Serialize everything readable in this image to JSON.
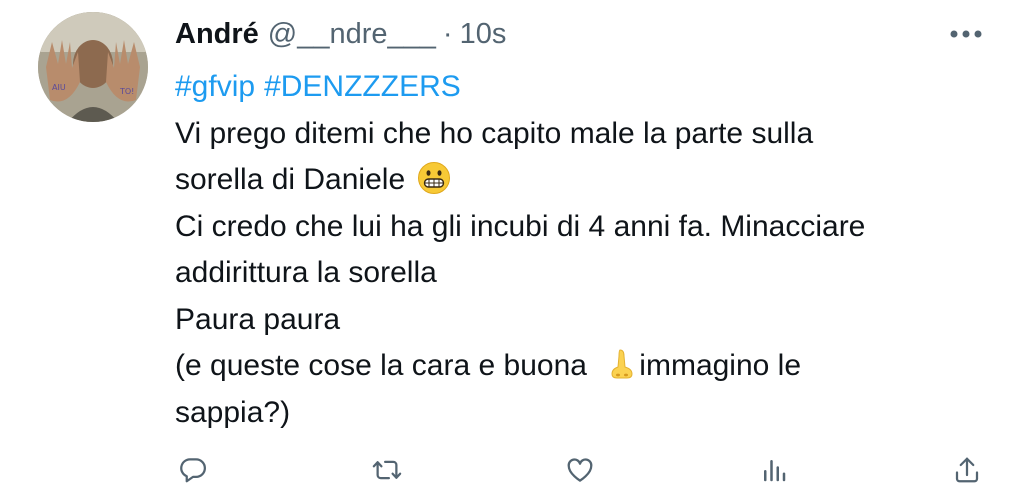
{
  "author": {
    "display_name": "André",
    "handle": "@__ndre___",
    "separator": "·",
    "time": "10s",
    "avatar_hand_text_left": "AIU",
    "avatar_hand_text_right": "TO!"
  },
  "tweet": {
    "hashtags": [
      "#gfvip",
      "#DENZZZERS"
    ],
    "lines": [
      "Vi prego ditemi che ho capito male la parte sulla",
      "sorella di Daniele",
      "Ci credo che lui ha gli incubi di 4 anni fa. Minacciare",
      "addirittura la sorella",
      "Paura paura",
      "(e queste cose la cara e buona",
      "immagino le",
      "sappia?)"
    ],
    "emojis": [
      "grimacing-face",
      "nose"
    ]
  },
  "icons": {
    "more": "more-horizontal-icon",
    "reply": "reply-icon",
    "retweet": "retweet-icon",
    "like": "like-icon",
    "views": "views-icon",
    "share": "share-icon"
  },
  "colors": {
    "text": "#0f1419",
    "secondary": "#536471",
    "link": "#1d9bf0",
    "background": "#ffffff"
  }
}
